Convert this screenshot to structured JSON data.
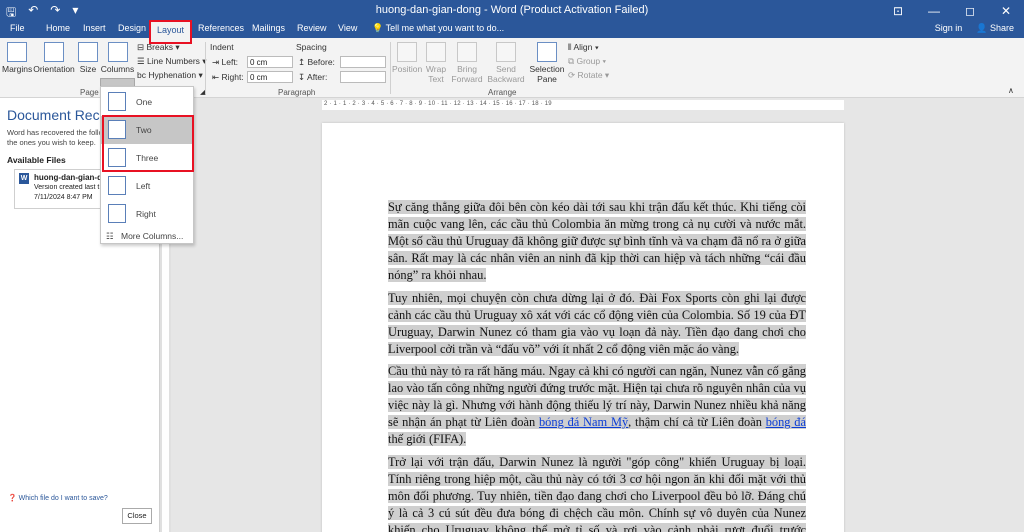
{
  "titlebar": {
    "title": "huong-dan-gian-dong - Word (Product Activation Failed)",
    "qat": [
      "save-icon",
      "undo-icon",
      "redo-icon",
      "customize-icon"
    ],
    "controls": [
      "—",
      "◻",
      "✕"
    ]
  },
  "tabs": {
    "items": [
      "File",
      "Home",
      "Insert",
      "Design",
      "Layout",
      "References",
      "Mailings",
      "Review",
      "View"
    ],
    "active": "Layout",
    "tell_me": "Tell me what you want to do...",
    "sign_in": "Sign in",
    "share": "Share"
  },
  "ribbon": {
    "page_setup": {
      "margins": "Margins",
      "orientation": "Orientation",
      "size": "Size",
      "columns": "Columns",
      "breaks": "Breaks",
      "line_numbers": "Line Numbers",
      "hyphenation": "Hyphenation",
      "group": "Page S"
    },
    "paragraph": {
      "indent": "Indent",
      "left_label": "Left:",
      "left_value": "0 cm",
      "right_label": "Right:",
      "right_value": "0 cm",
      "spacing": "Spacing",
      "before_label": "Before:",
      "after_label": "After:",
      "group": "Paragraph"
    },
    "arrange": {
      "position": "Position",
      "wrap_text": "Wrap Text",
      "bring_forward": "Bring Forward",
      "send_backward": "Send Backward",
      "selection_pane": "Selection Pane",
      "align": "Align",
      "group_btn": "Group",
      "rotate": "Rotate",
      "group": "Arrange"
    }
  },
  "columns_menu": {
    "items": [
      "One",
      "Two",
      "Three",
      "Left",
      "Right"
    ],
    "selected": "Two",
    "more": "More Columns..."
  },
  "recovery": {
    "heading": "Document Reco",
    "desc_1": "Word has recovered the follo",
    "desc_2": "the ones you wish to keep.",
    "available": "Available Files",
    "file_name": "huong-dan-gian-d",
    "file_meta": "Version created last t",
    "file_date": "7/11/2024 8:47 PM",
    "help": "Which file do I want to save?",
    "close": "Close"
  },
  "ruler": {
    "marks": "2 · 1 · 1 · 2 · 3 · 4 · 5 · 6 · 7 · 8 · 9 · 10 · 11 · 12 · 13 · 14 · 15 · 16 · 17 · 18 · 19"
  },
  "document": {
    "p1": "Sự căng thẳng giữa đôi bên còn kéo dài tới sau khi trận đấu kết thúc. Khi tiếng còi mãn cuộc vang lên, các cầu thủ Colombia ăn mừng trong cả nụ cười và nước mắt. Một số cầu thủ Uruguay đã không giữ được sự bình tĩnh và va chạm đã nổ ra ở giữa sân. Rất may là các nhân viên an ninh đã kịp thời can hiệp và tách những “cái đầu nóng” ra khỏi nhau.",
    "p2": "Tuy nhiên, mọi chuyện còn chưa dừng lại ở đó. Đài Fox Sports còn ghi lại được cảnh các cầu thủ Uruguay xô xát với các cổ động viên của Colombia. Số 19 của ĐT Uruguay, Darwin Nunez có tham gia vào vụ loạn đả này. Tiền đạo đang chơi cho Liverpool cởi trần và “đấu võ” với ít nhất 2 cổ động viên mặc áo vàng.",
    "p3_a": "Cầu thủ này tỏ ra rất hăng máu. Ngay cả khi có người can ngăn, Nunez vẫn cố gắng lao vào tấn công những người đứng trước mặt. Hiện tại chưa rõ nguyên nhân của vụ việc này là gì. Nhưng với hành động thiếu lý trí này, Darwin Nunez nhiều khả năng sẽ nhận án phạt từ Liên đoàn ",
    "p3_link1": "bóng đá Nam Mỹ",
    "p3_b": ", thậm chí cả từ Liên đoàn ",
    "p3_link2": "bóng đá",
    "p3_c": " thế giới (FIFA).",
    "p4": "Trở lại với trận đấu, Darwin Nunez là người \"góp công\" khiến Uruguay bị loại. Tính riêng trong hiệp một, cầu thủ này có tới 3 cơ hội ngon ăn khi đối mặt với thủ môn đối phương. Tuy nhiên, tiền đạo đang chơi cho Liverpool đều bỏ lỡ. Đáng chú ý là cả 3 cú sút đều đưa bóng đi chệch cầu môn. Chính sự vô duyên của Nunez khiến cho Uruguay không thể mở tỉ số và rơi vào cảnh phải rượt đuổi trước Colombia."
  },
  "colors": {
    "accent": "#2b579a",
    "highlight": "#e81123",
    "selection": "#cfcfcf"
  }
}
